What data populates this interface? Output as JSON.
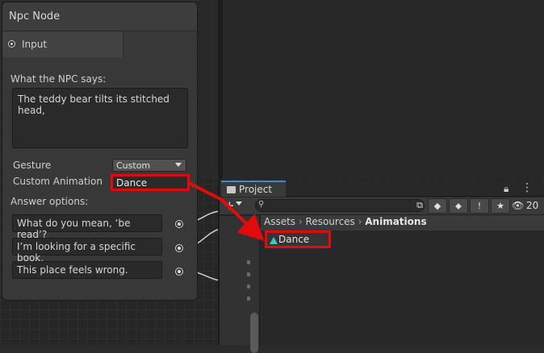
{
  "node": {
    "title": "Npc Node",
    "input_port_label": "Input",
    "says_label": "What the NPC says:",
    "says_text": "The teddy bear tilts its stitched head,",
    "gesture_label": "Gesture",
    "gesture_value": "Custom",
    "custom_animation_label": "Custom Animation",
    "custom_animation_value": "Dance",
    "answers_label": "Answer options:",
    "answers": [
      "What do you mean, ‘be read’?",
      "I’m looking for a specific book.",
      "This place feels wrong."
    ]
  },
  "project": {
    "tab_label": "Project",
    "add_label": "+",
    "search_placeholder": "",
    "visible_count": "20",
    "breadcrumb": [
      "Assets",
      "Resources",
      "Animations"
    ],
    "asset_name": "Dance"
  },
  "colors": {
    "highlight": "#e10b0b",
    "anim_icon": "#3ec7c7",
    "tab_accent": "#4a86c8"
  }
}
